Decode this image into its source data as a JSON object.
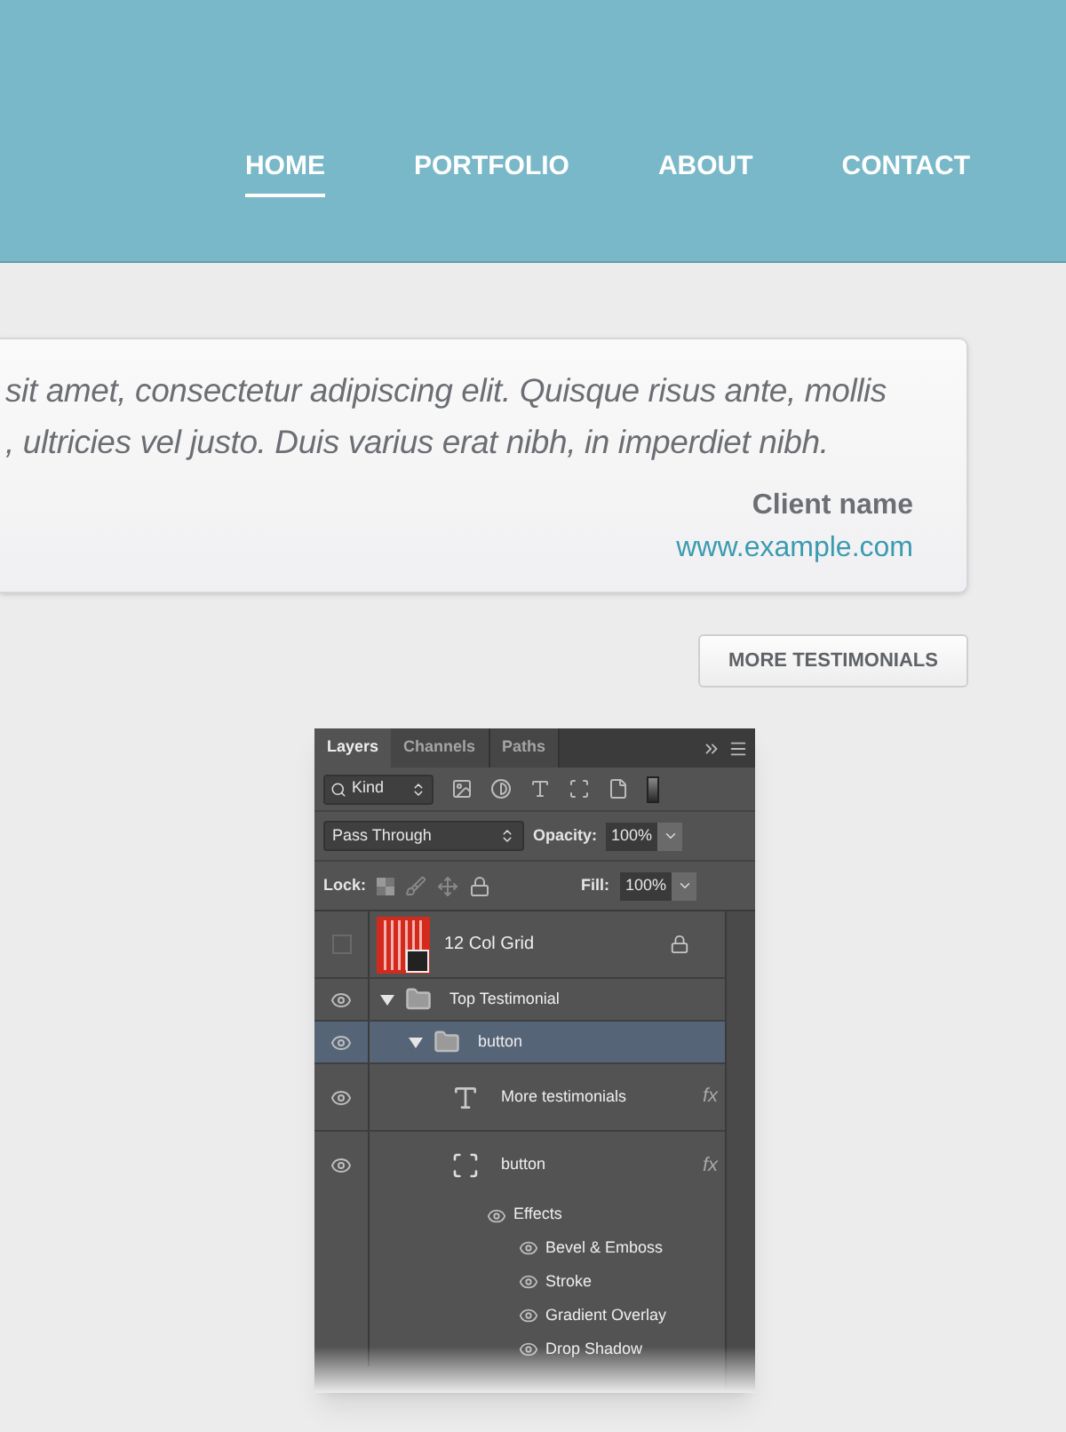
{
  "nav": [
    {
      "label": "HOME",
      "selected": true
    },
    {
      "label": "PORTFOLIO",
      "selected": false
    },
    {
      "label": "ABOUT",
      "selected": false
    },
    {
      "label": "CONTACT",
      "selected": false
    }
  ],
  "testimonial": {
    "quote_lines": [
      "sit amet, consectetur adipiscing elit. Quisque risus ante, mollis",
      ", ultricies vel justo. Duis varius erat nibh, in imperdiet nibh."
    ],
    "client_name": "Client name",
    "client_url": "www.example.com"
  },
  "more_button": "MORE TESTIMONIALS",
  "layers_panel": {
    "tabs": [
      {
        "label": "Layers",
        "selected": true
      },
      {
        "label": "Channels",
        "selected": false
      },
      {
        "label": "Paths",
        "selected": false
      }
    ],
    "filter": "Kind",
    "blend_mode": "Pass Through",
    "opacity_label": "Opacity:",
    "opacity": "100%",
    "lock_label": "Lock:",
    "fill_label": "Fill:",
    "fill": "100%",
    "layers": [
      {
        "kind": "grid",
        "name": "12 Col Grid",
        "visible": false,
        "locked": true,
        "selected": false
      },
      {
        "kind": "group",
        "name": "Top Testimonial",
        "visible": true,
        "expanded": true,
        "selected": false,
        "children": [
          {
            "kind": "group",
            "name": "button",
            "visible": true,
            "expanded": true,
            "selected": true,
            "children": [
              {
                "kind": "text",
                "name": "More testimonials",
                "visible": true,
                "selected": false,
                "fx": "fx"
              },
              {
                "kind": "shape",
                "name": "button",
                "visible": true,
                "selected": false,
                "fx": "fx",
                "effects_label": "Effects",
                "effects": [
                  "Bevel & Emboss",
                  "Stroke",
                  "Gradient Overlay",
                  "Drop Shadow"
                ]
              }
            ]
          }
        ]
      }
    ]
  }
}
